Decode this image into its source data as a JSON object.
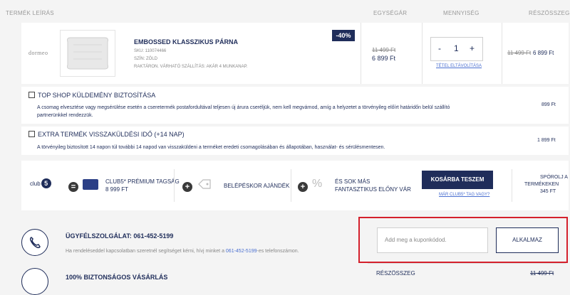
{
  "table_header": {
    "description": "TERMÉK LEÍRÁS",
    "unit_price": "EGYSÉGÁR",
    "quantity": "MENNYISÉG",
    "subtotal": "RÉSZÖSSZEG"
  },
  "product": {
    "brand": "DORMEO",
    "discount_badge": "-40%",
    "name": "EMBOSSED KLASSZIKUS PÁRNA",
    "sku": "SKU: 110074466",
    "color": "SZÍN: ZÖLD",
    "stock": "RAKTÁRON. VÁRHATÓ SZÁLLÍTÁS: AKÁR 4 MUNKANAP.",
    "old_price": "11 499 Ft",
    "price": "6 899 Ft",
    "qty_minus": "-",
    "qty_value": "1",
    "qty_plus": "+",
    "remove_label": "TÉTEL ELTÁVOLÍTÁSA",
    "subtotal_old": "11 499 Ft",
    "subtotal_new": "6 899 Ft"
  },
  "insurance": {
    "title": "TOP SHOP KÜLDEMÉNY BIZTOSÍTÁSA",
    "desc_line1": "A csomag elvesztése vagy megsérülése esetén a cseretermék postafordultával teljesen új árura cseréljük, nem kell megvárnod, amíg a helyzetet a törvényileg előírt határidőn belül szállító",
    "desc_line2": "partnerünkkel rendezzük.",
    "price": "899 Ft"
  },
  "return_ext": {
    "title": "EXTRA TERMÉK VISSZAKÜLDÉSI IDŐ (+14 NAP)",
    "desc": "A törvényileg biztosított 14 napon túl további 14 napod van visszaküldeni a terméket eredeti csomagolásában és állapotában, használat- és sérülésmentesen.",
    "price": "1 899 Ft"
  },
  "club": {
    "logo_text": "club",
    "logo_num": "5",
    "eq": "=",
    "membership_line1": "CLUB5* PRÉMIUM TAGSÁG",
    "membership_line2": "8 999 FT",
    "plus1": "+",
    "gift": "BELÉPÉSKOR AJÁNDÉK",
    "plus2": "+",
    "more_line1": "ÉS SOK MÁS",
    "more_line2": "FANTASZTIKUS ELŐNY VÁR",
    "cart_btn": "KOSÁRBA TESZEM",
    "member_link": "MÁR CLUB5* TAG VAGY?",
    "save_line1": "SPÓROLJ A",
    "save_line2": "TERMÉKEKEN",
    "save_line3": "345 FT"
  },
  "support": {
    "title": "ÜGYFÉLSZOLGÁLAT: 061-452-5199",
    "desc_pre": "Ha rendeléseddel kapcsolatban szeretnél segítséget kérni, hívj minket a ",
    "desc_phone": "061-452-5199",
    "desc_post": "-es telefonszámon."
  },
  "secure": {
    "title": "100% BIZTONSÁGOS VÁSÁRLÁS"
  },
  "coupon": {
    "placeholder": "Add meg a kuponkódod.",
    "apply_btn": "ALKALMAZ"
  },
  "summary": {
    "label": "RÉSZÖSSZEG",
    "value": "11 499 Ft"
  },
  "colors": {
    "navy": "#1f2d5a",
    "badge": "#1f2d5a",
    "highlight": "#d4202c",
    "link": "#4a6fd0"
  }
}
